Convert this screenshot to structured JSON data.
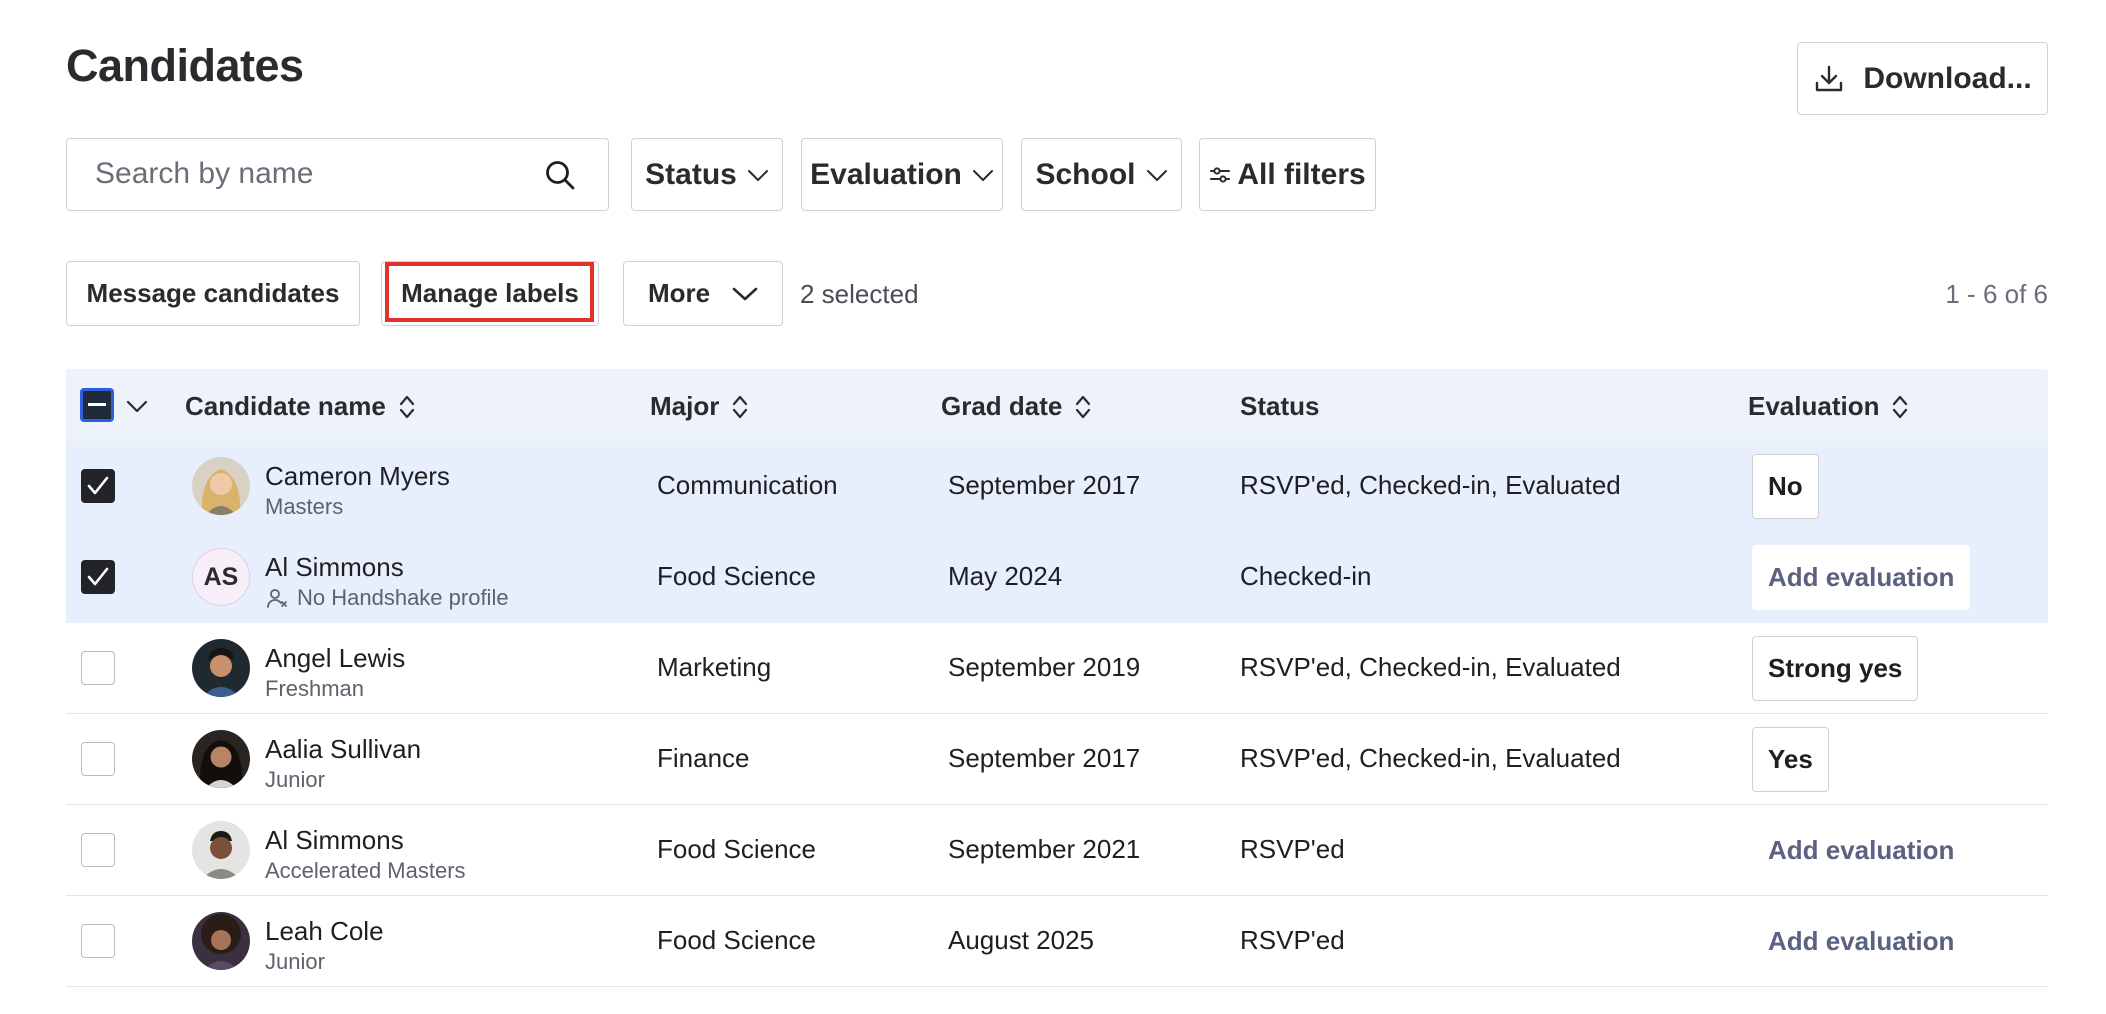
{
  "header": {
    "title": "Candidates",
    "download_label": "Download..."
  },
  "search": {
    "placeholder": "Search by name",
    "value": ""
  },
  "filters": {
    "status": "Status",
    "evaluation": "Evaluation",
    "school": "School",
    "all_filters": "All filters"
  },
  "actions": {
    "message": "Message candidates",
    "manage_labels": "Manage labels",
    "more": "More",
    "selected_count": "2 selected",
    "pagination": "1 - 6 of 6"
  },
  "table": {
    "columns": {
      "name": "Candidate name",
      "major": "Major",
      "grad_date": "Grad date",
      "status": "Status",
      "evaluation": "Evaluation"
    },
    "rows": [
      {
        "selected": true,
        "name": "Cameron Myers",
        "sub": "Masters",
        "major": "Communication",
        "grad_date": "September 2017",
        "status": "RSVP'ed, Checked-in, Evaluated",
        "evaluation": "No",
        "evaluation_type": "chip",
        "avatar": "photo-woman-blonde"
      },
      {
        "selected": true,
        "name": "Al Simmons",
        "sub": "No Handshake profile",
        "sub_icon": "no-profile-icon",
        "major": "Food Science",
        "grad_date": "May 2024",
        "status": "Checked-in",
        "evaluation": "Add evaluation",
        "evaluation_type": "add",
        "avatar_initials": "AS"
      },
      {
        "selected": false,
        "name": "Angel Lewis",
        "sub": "Freshman",
        "major": "Marketing",
        "grad_date": "September 2019",
        "status": "RSVP'ed, Checked-in, Evaluated",
        "evaluation": "Strong yes",
        "evaluation_type": "chip",
        "avatar": "photo-man-dark-hair"
      },
      {
        "selected": false,
        "name": "Aalia Sullivan",
        "sub": "Junior",
        "major": "Finance",
        "grad_date": "September 2017",
        "status": "RSVP'ed, Checked-in, Evaluated",
        "evaluation": "Yes",
        "evaluation_type": "chip",
        "avatar": "photo-woman-dark-hair"
      },
      {
        "selected": false,
        "name": "Al Simmons",
        "sub": "Accelerated Masters",
        "major": "Food Science",
        "grad_date": "September 2021",
        "status": "RSVP'ed",
        "evaluation": "Add evaluation",
        "evaluation_type": "add",
        "avatar": "photo-man-smiling"
      },
      {
        "selected": false,
        "name": "Leah Cole",
        "sub": "Junior",
        "major": "Food Science",
        "grad_date": "August 2025",
        "status": "RSVP'ed",
        "evaluation": "Add evaluation",
        "evaluation_type": "add",
        "avatar": "photo-woman-curly-hair"
      }
    ]
  },
  "colors": {
    "highlight": "#e0342a",
    "selected_row": "#e7eefc",
    "header_row": "#eef2fb",
    "checkbox_checked": "#23232a",
    "accent_border": "#2f5de0"
  }
}
